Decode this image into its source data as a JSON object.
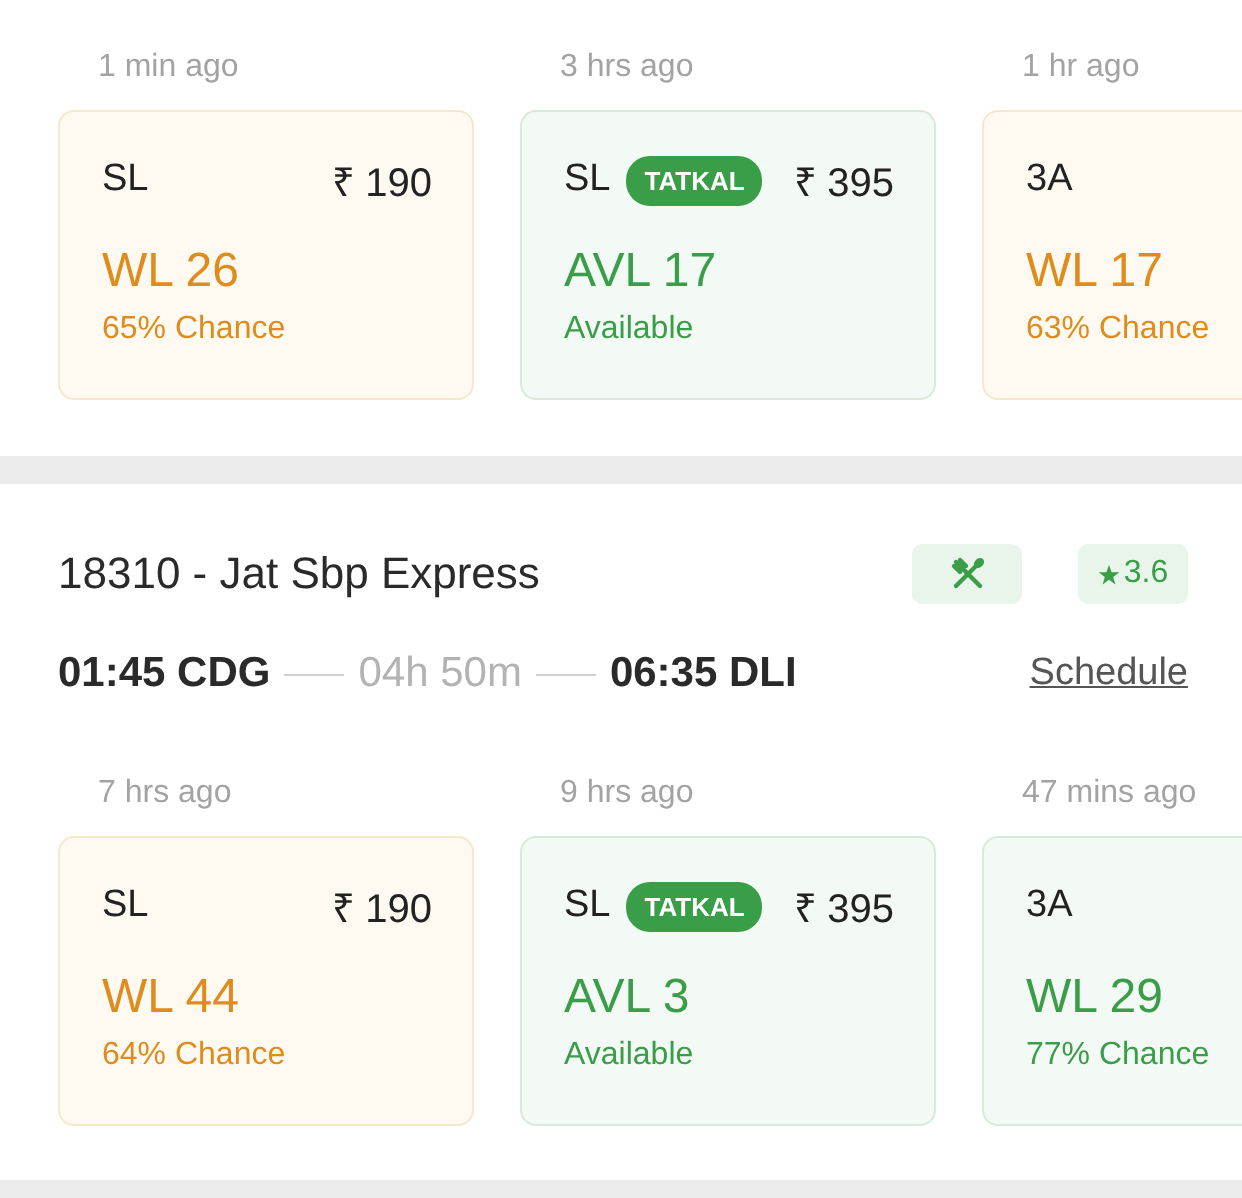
{
  "top_availability": {
    "cards": [
      {
        "updated": "1 min ago",
        "travel_class": "SL",
        "price": "₹ 190",
        "status": "WL 26",
        "chance": "65% Chance",
        "kind": "warning"
      },
      {
        "updated": "3 hrs ago",
        "travel_class": "SL",
        "quota": "TATKAL",
        "price": "₹ 395",
        "status": "AVL 17",
        "chance": "Available",
        "kind": "success"
      },
      {
        "updated": "1 hr ago",
        "travel_class": "3A",
        "status": "WL 17",
        "chance": "63% Chance",
        "kind": "warning"
      }
    ]
  },
  "train": {
    "title": "18310 - Jat Sbp Express",
    "amenity": {
      "kind": "food"
    },
    "rating": "3.6",
    "departure": "01:45 CDG",
    "duration": "04h 50m",
    "arrival": "06:35 DLI",
    "schedule_link": "Schedule",
    "cards": [
      {
        "updated": "7 hrs ago",
        "travel_class": "SL",
        "price": "₹ 190",
        "status": "WL 44",
        "chance": "64% Chance",
        "kind": "warning"
      },
      {
        "updated": "9 hrs ago",
        "travel_class": "SL",
        "quota": "TATKAL",
        "price": "₹ 395",
        "status": "AVL 3",
        "chance": "Available",
        "kind": "success"
      },
      {
        "updated": "47 mins ago",
        "travel_class": "3A",
        "status": "WL 29",
        "chance": "77% Chance",
        "kind": "success"
      }
    ]
  }
}
